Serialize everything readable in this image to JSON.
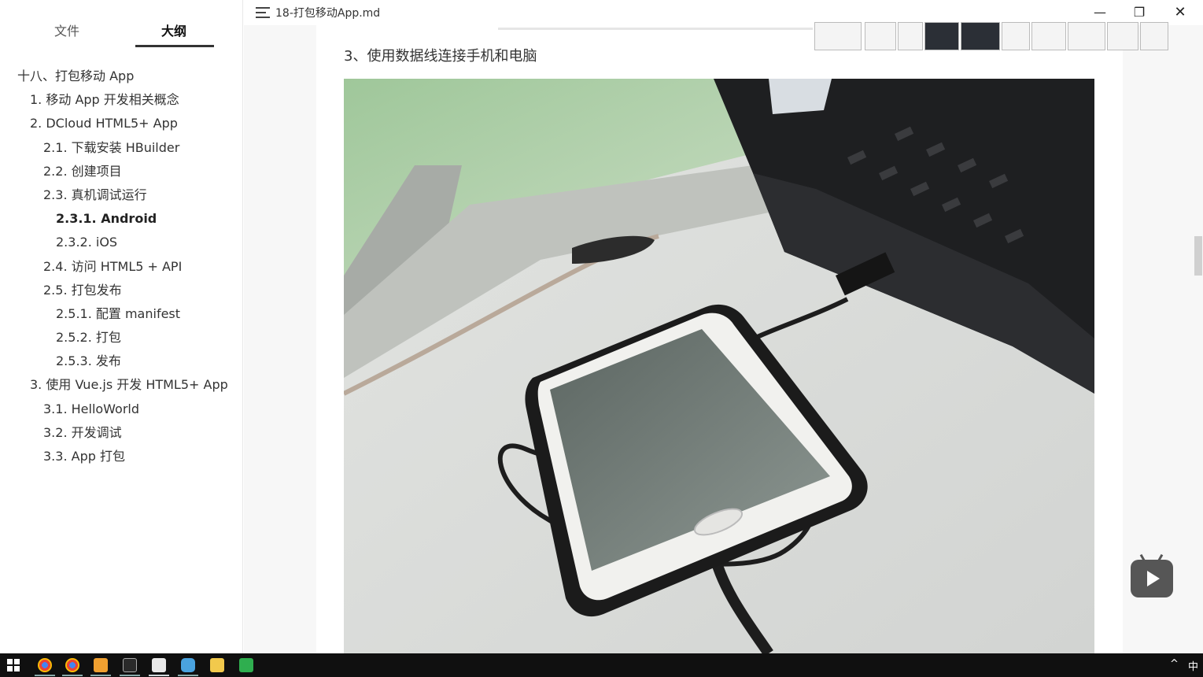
{
  "sidebar": {
    "tabs": {
      "files": "文件",
      "outline": "大纲"
    },
    "outline": [
      {
        "label": "十八、打包移动 App",
        "level": 0
      },
      {
        "label": "1. 移动 App 开发相关概念",
        "level": 1
      },
      {
        "label": "2. DCloud HTML5+ App",
        "level": 1
      },
      {
        "label": "2.1. 下载安装 HBuilder",
        "level": 2
      },
      {
        "label": "2.2. 创建项目",
        "level": 2
      },
      {
        "label": "2.3. 真机调试运行",
        "level": 2
      },
      {
        "label": "2.3.1. Android",
        "level": 3,
        "active": true
      },
      {
        "label": "2.3.2. iOS",
        "level": 3
      },
      {
        "label": "2.4. 访问 HTML5 + API",
        "level": 2
      },
      {
        "label": "2.5. 打包发布",
        "level": 2
      },
      {
        "label": "2.5.1. 配置 manifest",
        "level": 3
      },
      {
        "label": "2.5.2. 打包",
        "level": 3
      },
      {
        "label": "2.5.3. 发布",
        "level": 3
      },
      {
        "label": "3. 使用 Vue.js 开发 HTML5+ App",
        "level": 1
      },
      {
        "label": "3.1. HelloWorld",
        "level": 2
      },
      {
        "label": "3.2. 开发调试",
        "level": 2
      },
      {
        "label": "3.3. App 打包",
        "level": 2
      }
    ]
  },
  "titlebar": {
    "doc_title": "18-打包移动App.md",
    "minimize": "—",
    "maximize": "❐",
    "close": "✕"
  },
  "content": {
    "heading": "3、使用数据线连接手机和电脑"
  },
  "taskbar": {
    "tray_chevron": "^",
    "ime": "中",
    "apps": [
      "chrome-icon",
      "chrome-icon",
      "sublime-icon",
      "terminal-icon",
      "typora-icon",
      "cloud-icon",
      "folder-icon",
      "hbuilder-icon"
    ]
  },
  "colors": {
    "accent_underline": "#333333",
    "taskbar_bg": "#101010",
    "page_bg": "#f7f7f7"
  }
}
